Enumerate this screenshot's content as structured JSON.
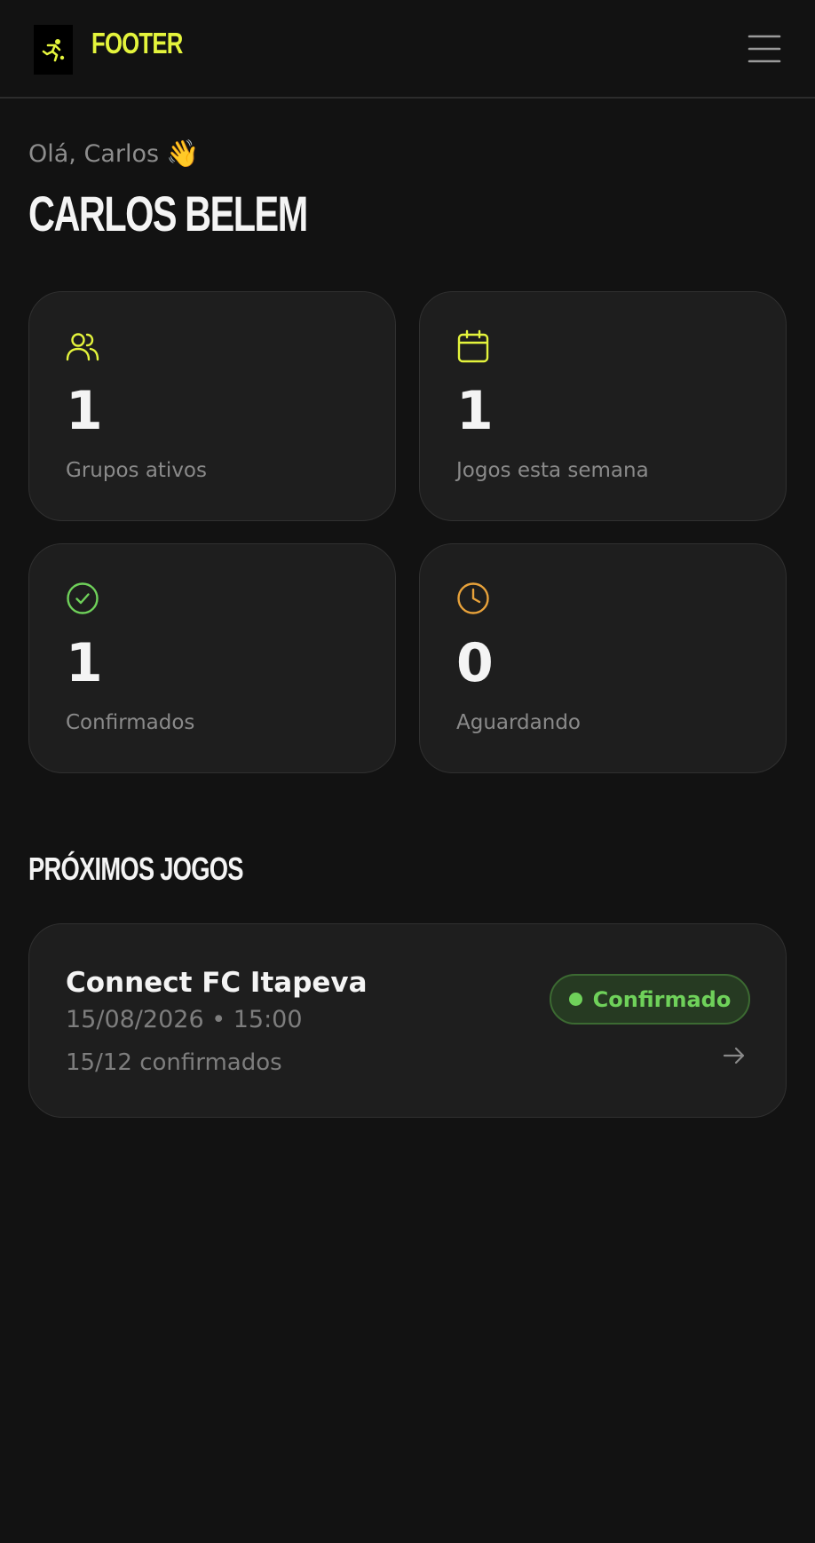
{
  "header": {
    "brand": "FOOTER",
    "logo_icon": "runner-icon",
    "menu_icon": "hamburger-menu-icon"
  },
  "colors": {
    "background": "#121212",
    "card": "#1e1e1e",
    "accent": "#e4f43c",
    "success": "#6fd15a",
    "warning": "#e8a23a",
    "muted_text": "#8a8a8a"
  },
  "greeting": {
    "text": "Olá, Carlos",
    "emoji": "👋"
  },
  "user": {
    "name": "CARLOS BELEM"
  },
  "stats": [
    {
      "icon": "users-icon",
      "value": "1",
      "label": "Grupos ativos"
    },
    {
      "icon": "calendar-icon",
      "value": "1",
      "label": "Jogos esta semana"
    },
    {
      "icon": "check-circle-icon",
      "value": "1",
      "label": "Confirmados"
    },
    {
      "icon": "clock-icon",
      "value": "0",
      "label": "Aguardando"
    }
  ],
  "upcoming": {
    "title": "PRÓXIMOS JOGOS",
    "games": [
      {
        "name": "Connect FC Itapeva",
        "datetime": "15/08/2026 • 15:00",
        "confirmed": "15/12 confirmados",
        "status": "Confirmado"
      }
    ]
  }
}
